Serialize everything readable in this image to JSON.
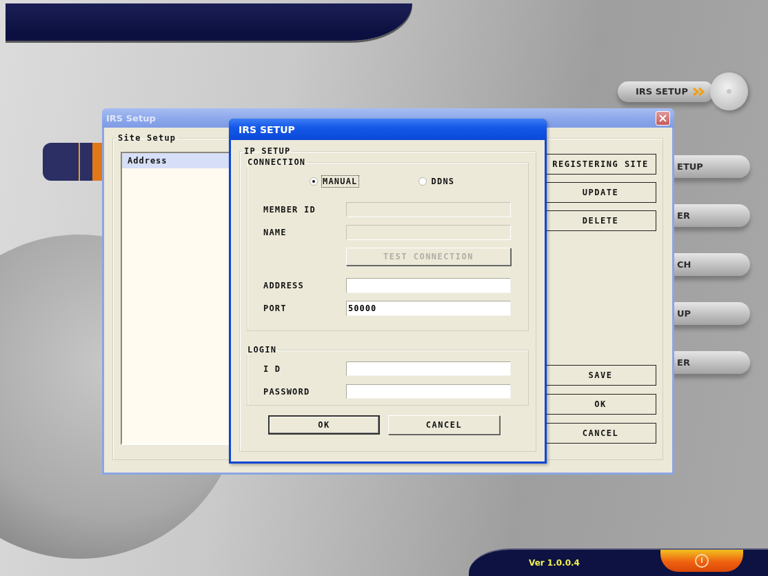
{
  "background_app": {
    "menu": [
      {
        "label": "IRS SETUP",
        "selected": true
      },
      {
        "label": "ETUP",
        "selected": false
      },
      {
        "label": "ER",
        "selected": false
      },
      {
        "label": "CH",
        "selected": false
      },
      {
        "label": "UP",
        "selected": false
      },
      {
        "label": "ER",
        "selected": false
      }
    ],
    "version": "Ver 1.0.0.4"
  },
  "site_dialog": {
    "title": "IRS Setup",
    "group": "Site Setup",
    "list_columns": [
      "Address"
    ],
    "buttons": [
      "REGISTERING SITE",
      "UPDATE",
      "DELETE"
    ],
    "bottom_buttons": [
      "SAVE",
      "OK",
      "CANCEL"
    ]
  },
  "irs_dialog": {
    "title": "IRS SETUP",
    "ip_group": "IP SETUP",
    "connection_group": "CONNECTION",
    "modes": [
      {
        "label": "MANUAL",
        "selected": true,
        "focused": true
      },
      {
        "label": "DDNS",
        "selected": false,
        "focused": false
      }
    ],
    "connection_items": [
      {
        "kind": "field",
        "label": "MEMBER ID",
        "disabled": true
      },
      {
        "kind": "field",
        "label": "NAME",
        "disabled": true
      },
      {
        "kind": "button",
        "label": "TEST CONNECTION",
        "disabled": true
      },
      {
        "kind": "field",
        "label": "ADDRESS",
        "disabled": false
      },
      {
        "kind": "field",
        "label": "PORT",
        "value": "50000",
        "disabled": false
      }
    ],
    "login_group": "LOGIN",
    "login_fields": [
      {
        "label": "I D"
      },
      {
        "label": "PASSWORD"
      }
    ],
    "buttons": [
      {
        "label": "OK",
        "default": true
      },
      {
        "label": "CANCEL",
        "default": false
      }
    ]
  }
}
